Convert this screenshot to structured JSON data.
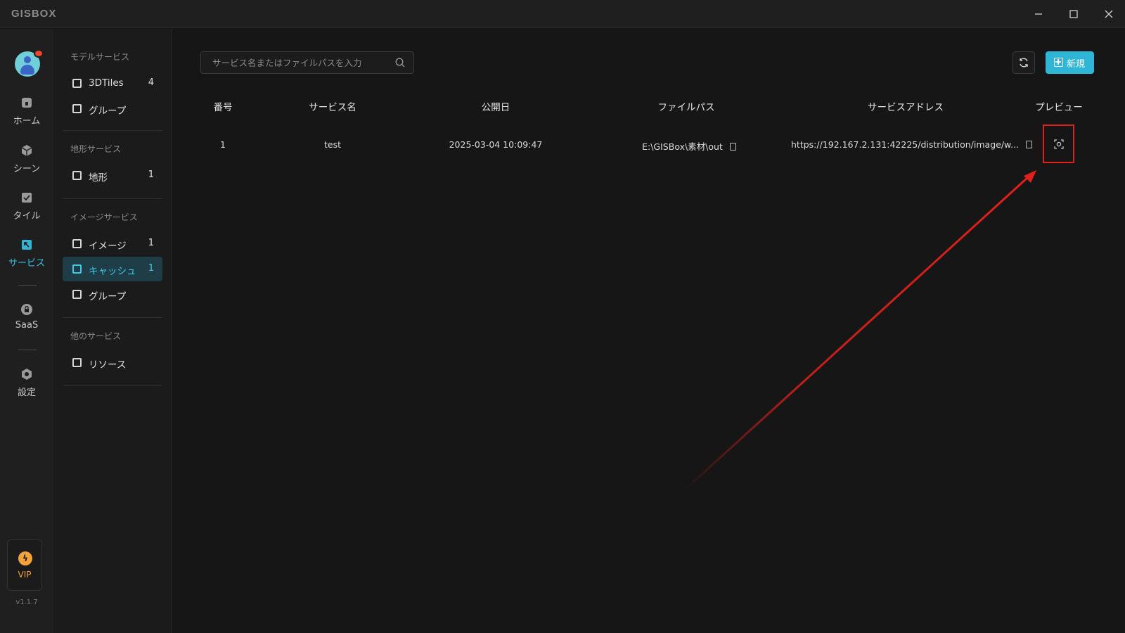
{
  "app": {
    "brand": "GISBOX"
  },
  "rail": {
    "items": [
      {
        "label": "ホーム",
        "icon": "home-icon"
      },
      {
        "label": "シーン",
        "icon": "scene-icon"
      },
      {
        "label": "タイル",
        "icon": "tile-icon"
      },
      {
        "label": "サービス",
        "icon": "service-icon",
        "active": true
      },
      {
        "label": "SaaS",
        "icon": "saas-icon"
      },
      {
        "label": "設定",
        "icon": "settings-icon"
      }
    ],
    "vip_label": "VIP",
    "version": "v1.1.7"
  },
  "sidebar": {
    "model_title": "モデルサービス",
    "model_items": [
      {
        "label": "3DTiles",
        "count": "4"
      },
      {
        "label": "グループ",
        "count": ""
      }
    ],
    "terrain_title": "地形サービス",
    "terrain_items": [
      {
        "label": "地形",
        "count": "1"
      }
    ],
    "image_title": "イメージサービス",
    "image_items": [
      {
        "label": "イメージ",
        "count": "1"
      },
      {
        "label": "キャッシュ",
        "count": "1",
        "active": true
      },
      {
        "label": "グループ",
        "count": ""
      }
    ],
    "other_title": "他のサービス",
    "other_items": [
      {
        "label": "リソース",
        "count": ""
      }
    ]
  },
  "toolbar": {
    "search_placeholder": "サービス名またはファイルパスを入力",
    "new_label": "新規"
  },
  "table": {
    "headers": [
      "番号",
      "サービス名",
      "公開日",
      "ファイルパス",
      "サービスアドレス",
      "プレビュー"
    ],
    "rows": [
      {
        "no": "1",
        "name": "test",
        "date": "2025-03-04 10:09:47",
        "path": "E:\\GISBox\\素材\\out",
        "address": "https://192.167.2.131:42225/distribution/image/w..."
      }
    ]
  },
  "colors": {
    "accent": "#2fb5d6",
    "highlight": "#e0201a",
    "vip": "#f2a43a"
  }
}
